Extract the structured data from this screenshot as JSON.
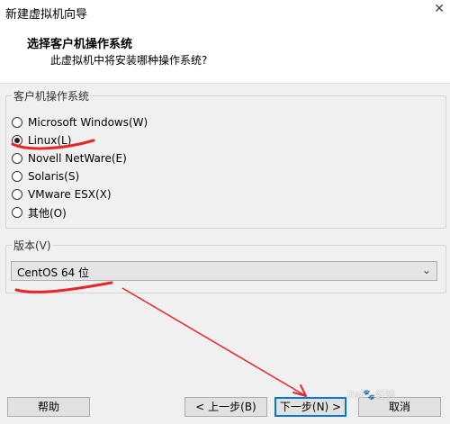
{
  "window": {
    "title": "新建虚拟机向导",
    "close_glyph": "✕"
  },
  "header": {
    "title": "选择客户机操作系统",
    "subtitle": "此虚拟机中将安装哪种操作系统?"
  },
  "guest_os": {
    "legend": "客户机操作系统",
    "options": [
      {
        "label": "Microsoft Windows(W)",
        "checked": false
      },
      {
        "label": "Linux(L)",
        "checked": true
      },
      {
        "label": "Novell NetWare(E)",
        "checked": false
      },
      {
        "label": "Solaris(S)",
        "checked": false
      },
      {
        "label": "VMware ESX(X)",
        "checked": false
      },
      {
        "label": "其他(O)",
        "checked": false
      }
    ]
  },
  "version": {
    "legend": "版本(V)",
    "selected": "CentOS 64 位",
    "caret": "⌄"
  },
  "buttons": {
    "help": "帮助",
    "back": "< 上一步(B)",
    "next": "下一步(N) >",
    "cancel": "取消"
  },
  "watermark": "Bai🐾经验",
  "annotation_color": "#e8262a"
}
